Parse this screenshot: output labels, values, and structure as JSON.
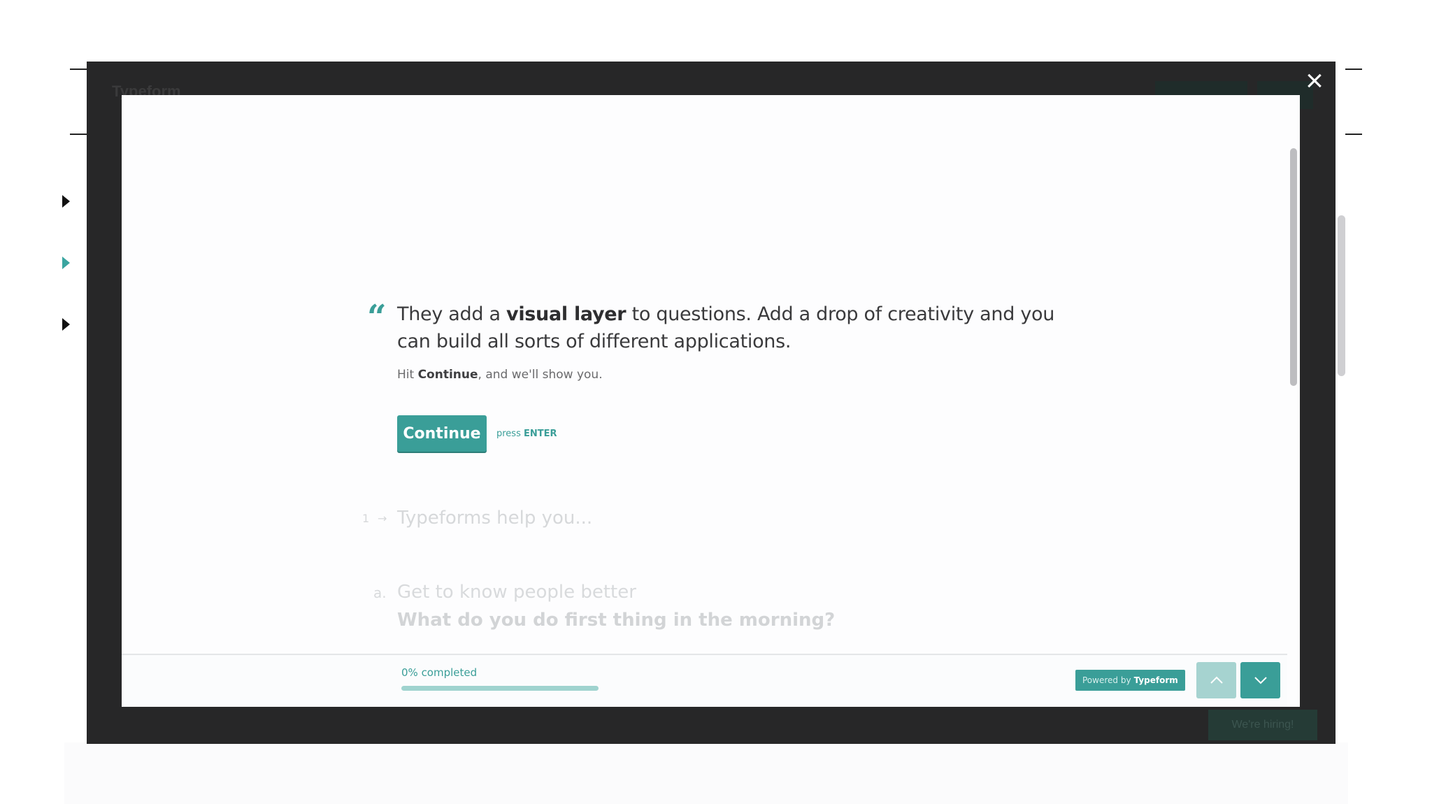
{
  "question": {
    "text_before": "They add a ",
    "text_bold": "visual layer",
    "text_after": " to questions. Add a drop of creativity and you can build all sorts of different applications.",
    "quote_mark": "“",
    "hint_before": "Hit ",
    "hint_bold": "Continue",
    "hint_after": ", and we'll show you."
  },
  "continue": {
    "label": "Continue",
    "press_prefix": "press ",
    "press_key": "ENTER"
  },
  "next_question": {
    "number": "1",
    "arrow": "→",
    "text": "Typeforms help you..."
  },
  "choice": {
    "key": "a.",
    "label": "Get to know people better",
    "sub": "What do you do first thing in the morning?"
  },
  "footer": {
    "progress_label": "0% completed",
    "progress_fraction": 0,
    "powered_prefix": "Powered by ",
    "powered_brand": "Typeform"
  },
  "overlay": {
    "close_glyph": "×"
  },
  "background": {
    "site_title": "Typeform",
    "cta_label": "We're hiring!"
  },
  "colors": {
    "accent": "#3a9e98",
    "overlay": "#272728"
  },
  "icons": {
    "close": "close-icon",
    "quote": "quote-icon",
    "up": "chevron-up-icon",
    "down": "chevron-down-icon"
  }
}
